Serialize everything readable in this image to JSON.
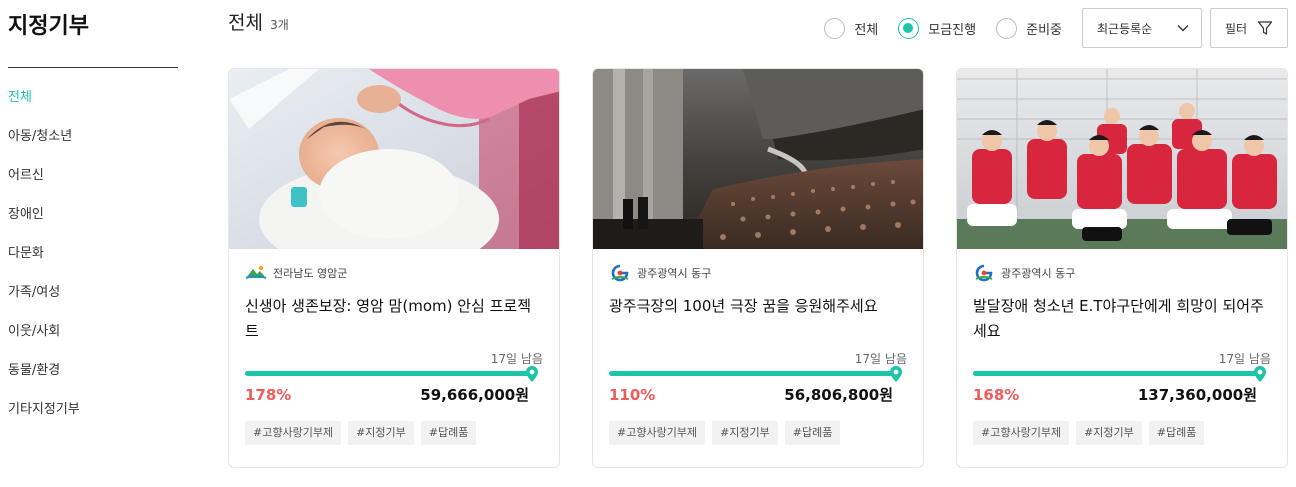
{
  "sidebar": {
    "title": "지정기부",
    "items": [
      {
        "label": "전체",
        "active": true
      },
      {
        "label": "아동/청소년",
        "active": false
      },
      {
        "label": "어르신",
        "active": false
      },
      {
        "label": "장애인",
        "active": false
      },
      {
        "label": "다문화",
        "active": false
      },
      {
        "label": "가족/여성",
        "active": false
      },
      {
        "label": "이웃/사회",
        "active": false
      },
      {
        "label": "동물/환경",
        "active": false
      },
      {
        "label": "기타지정기부",
        "active": false
      }
    ]
  },
  "header": {
    "title": "전체",
    "count": "3개"
  },
  "filters": {
    "radios": [
      {
        "label": "전체",
        "checked": false
      },
      {
        "label": "모금진행",
        "checked": true
      },
      {
        "label": "준비중",
        "checked": false
      }
    ],
    "sort_label": "최근등록순",
    "filter_label": "필터"
  },
  "colors": {
    "accent": "#1cc4a8",
    "percent": "#f05b5b"
  },
  "cards": [
    {
      "org": "전라남도 영암군",
      "org_logo": "yeongam-logo",
      "image": "newborn-baby-photo",
      "title": "신생아 생존보장: 영암 맘(mom) 안심 프로젝트",
      "days_left": "17일 남음",
      "progress": 1.0,
      "percent": "178%",
      "amount": "59,666,000원",
      "tags": [
        "#고향사랑기부제",
        "#지정기부",
        "#답례품"
      ]
    },
    {
      "org": "광주광역시 동구",
      "org_logo": "gwangju-donggu-logo",
      "image": "theater-audience-photo",
      "title": "광주극장의 100년 극장 꿈을 응원해주세요",
      "days_left": "17일 남음",
      "progress": 1.0,
      "percent": "110%",
      "amount": "56,806,800원",
      "tags": [
        "#고향사랑기부제",
        "#지정기부",
        "#답례품"
      ]
    },
    {
      "org": "광주광역시 동구",
      "org_logo": "gwangju-donggu-logo",
      "image": "baseball-team-photo",
      "title": "발달장애 청소년 E.T야구단에게 희망이 되어주세요",
      "days_left": "17일 남음",
      "progress": 1.0,
      "percent": "168%",
      "amount": "137,360,000원",
      "tags": [
        "#고향사랑기부제",
        "#지정기부",
        "#답례품"
      ]
    }
  ]
}
